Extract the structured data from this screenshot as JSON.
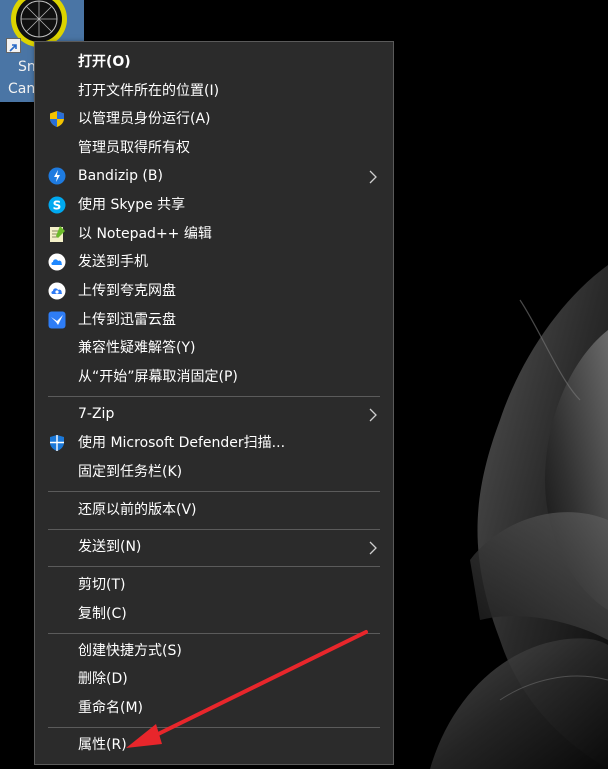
{
  "desktop_icon": {
    "label_line1": "Sn",
    "label_line2": "Can",
    "icon": "app-logo-icon"
  },
  "context_menu": {
    "items": [
      {
        "label": "打开(O)",
        "icon": "",
        "bold": true
      },
      {
        "label": "打开文件所在的位置(I)",
        "icon": ""
      },
      {
        "label": "以管理员身份运行(A)",
        "icon": "uac-shield-icon"
      },
      {
        "label": "管理员取得所有权",
        "icon": ""
      },
      {
        "label": "Bandizip (B)",
        "icon": "bandizip-icon",
        "submenu": true
      },
      {
        "label": "使用 Skype 共享",
        "icon": "skype-icon"
      },
      {
        "label": "以 Notepad++ 编辑",
        "icon": "notepadpp-icon"
      },
      {
        "label": "发送到手机",
        "icon": "cloud-phone-icon"
      },
      {
        "label": "上传到夸克网盘",
        "icon": "quark-drive-icon"
      },
      {
        "label": "上传到迅雷云盘",
        "icon": "xunlei-icon"
      },
      {
        "label": "兼容性疑难解答(Y)",
        "icon": ""
      },
      {
        "label": "从“开始”屏幕取消固定(P)",
        "icon": ""
      },
      {
        "label": "7-Zip",
        "icon": "",
        "submenu": true
      },
      {
        "label": "使用 Microsoft Defender扫描...",
        "icon": "defender-shield-icon"
      },
      {
        "label": "固定到任务栏(K)",
        "icon": ""
      },
      {
        "label": "还原以前的版本(V)",
        "icon": ""
      },
      {
        "label": "发送到(N)",
        "icon": "",
        "submenu": true
      },
      {
        "label": "剪切(T)",
        "icon": ""
      },
      {
        "label": "复制(C)",
        "icon": ""
      },
      {
        "label": "创建快捷方式(S)",
        "icon": ""
      },
      {
        "label": "删除(D)",
        "icon": ""
      },
      {
        "label": "重命名(M)",
        "icon": ""
      },
      {
        "label": "属性(R)",
        "icon": ""
      }
    ]
  },
  "colors": {
    "menu_background": "#2b2b2b",
    "menu_text": "#ffffff",
    "separator": "#5b5b5b",
    "annotation_arrow": "#e8262b"
  }
}
